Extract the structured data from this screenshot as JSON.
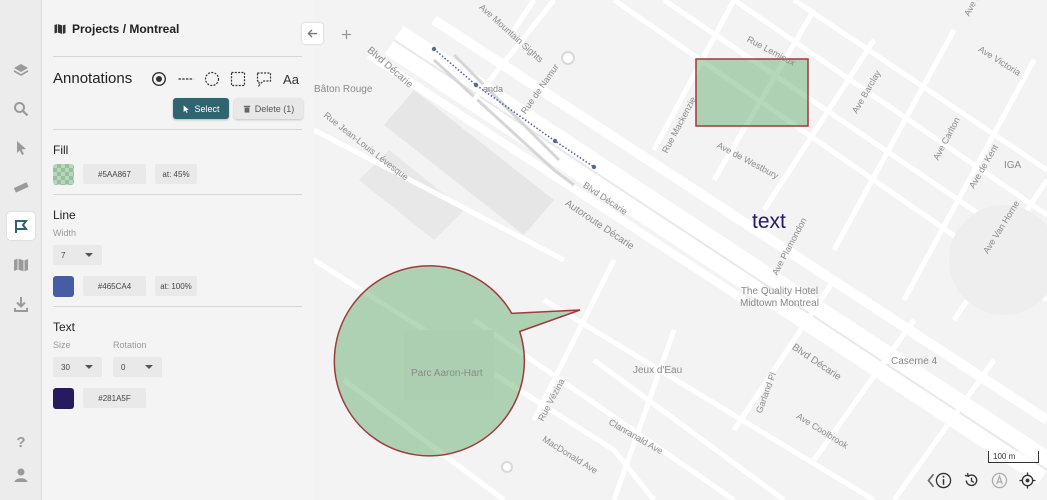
{
  "breadcrumb": "Projects / Montreal",
  "annotations": {
    "title": "Annotations",
    "tools": [
      "point-tool",
      "line-tool",
      "circle-tool",
      "rectangle-tool",
      "polygon-tool",
      "text-tool"
    ],
    "text_tool_label": "Aa",
    "select_label": "Select",
    "delete_label": "Delete (1)"
  },
  "fill": {
    "title": "Fill",
    "color": "#5AA867",
    "color_label": "#5AA867",
    "alpha_label": "at: 45%"
  },
  "line": {
    "title": "Line",
    "width_label": "Width",
    "width_value": "7",
    "color": "#465CA4",
    "color_label": "#465CA4",
    "alpha_label": "at: 100%"
  },
  "text": {
    "title": "Text",
    "size_label": "Size",
    "size_value": "30",
    "rotation_label": "Rotation",
    "rotation_value": "0",
    "color": "#281A5F",
    "color_label": "#281A5F"
  },
  "map": {
    "annotation_text": "text",
    "scale_label": "100 m",
    "labels": {
      "mountain_sights": "Ave Mountain Sights",
      "baton_rouge": "Bâton Rouge",
      "blvd_decarie_1": "Blvd Décarie",
      "blvd_decarie_2": "Blvd Décarie",
      "blvd_decarie_3": "Blvd Décarie",
      "autoroute": "Autoroute Décarie",
      "jean_louis": "Rue Jean-Louis Lévesque",
      "namur": "Rue de Namur",
      "anda": "anda",
      "mackenzie": "Rue Mackenzie",
      "westbury": "Ave de Westbury",
      "barclay": "Ave Barclay",
      "lemieux": "Rue Lemieux",
      "victoria": "Ave Victoria",
      "carlton": "Ave Carlton",
      "de_kent": "Ave de Kent",
      "van_horne": "Ave Van Horne",
      "plamondon": "Ave Plamondon",
      "garland": "Garland Pl",
      "coolbrook": "Ave Coolbrook",
      "clanranald": "Clanranald Ave",
      "macdonald": "MacDonald Ave",
      "vezina": "Rue Vézina",
      "parc": "Parc Aaron-Hart",
      "jeux": "Jeux d'Eau",
      "caserne": "Caserne 4",
      "iga": "IGA",
      "hotel": "The Quality Hotel\nMidtown Montreal",
      "ave_d": "Ave D"
    }
  }
}
